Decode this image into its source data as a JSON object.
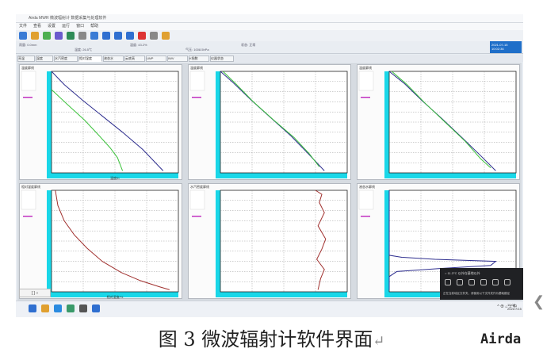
{
  "window": {
    "title": "Airda MWR 微波辐射计 数据采集与处理软件"
  },
  "menu": [
    "文件",
    "查看",
    "设置",
    "运行",
    "窗口",
    "帮助"
  ],
  "toolbar_icons": [
    "save-icon",
    "open-icon",
    "print-icon",
    "chart-icon",
    "calibrate-icon",
    "settings-icon",
    "camera-icon",
    "play-icon",
    "pause-icon",
    "stop-icon",
    "record-icon",
    "antenna-icon",
    "help-icon"
  ],
  "toolbar2": [
    "雨量: 0.0mm",
    "温度: 26.5℃",
    "湿度: 43.2%",
    "气压: 1008.5hPa",
    "状态: 正常"
  ],
  "status_box": [
    "2021-07-15",
    "10:02:36"
  ],
  "tabs": [
    "亮温",
    "温度",
    "水汽密度",
    "相对湿度",
    "液态水",
    "云底高",
    "LWP",
    "IWV",
    "K指数",
    "仪器状态"
  ],
  "tabs_active": 3,
  "colors": {
    "blue_line": "#2f2f8f",
    "green_line": "#3cc23c",
    "red_line": "#a0302e",
    "axis_fill": "#19d7e8",
    "legend_text": "#c030c0"
  },
  "panels": [
    {
      "title": "温度廓线",
      "xlabel": "温度/K"
    },
    {
      "title": "温度廓线",
      "xlabel": ""
    },
    {
      "title": "温度廓线",
      "xlabel": ""
    },
    {
      "title": "相对湿度廓线",
      "xlabel": "相对湿度/%"
    },
    {
      "title": "水汽密度廓线",
      "xlabel": ""
    },
    {
      "title": "液态水廓线",
      "xlabel": ""
    }
  ],
  "chart_data": [
    {
      "type": "line",
      "title": "温度廓线",
      "xlabel": "温度/K",
      "series": [
        {
          "x": [
            250,
            255,
            262,
            270,
            278,
            286,
            294
          ],
          "y": [
            10,
            8.7,
            7.2,
            5.6,
            4.0,
            2.3,
            0.2
          ]
        },
        {
          "x": [
            250,
            256,
            263,
            269,
            273,
            276,
            278
          ],
          "y": [
            8.2,
            6.8,
            5.2,
            3.6,
            2.5,
            1.5,
            0.2
          ]
        }
      ]
    },
    {
      "type": "line",
      "title": "温度廓线",
      "series": [
        {
          "x": [
            250,
            255,
            262,
            270,
            278,
            285,
            291
          ],
          "y": [
            10,
            8.9,
            7.2,
            5.4,
            3.6,
            1.8,
            0.2
          ]
        },
        {
          "x": [
            251,
            256,
            263,
            271,
            279,
            285,
            289
          ],
          "y": [
            10,
            8.8,
            7.0,
            5.2,
            3.5,
            1.9,
            0.6
          ]
        }
      ]
    },
    {
      "type": "line",
      "title": "温度廓线",
      "series": [
        {
          "x": [
            250,
            256,
            263,
            271,
            279,
            286,
            292
          ],
          "y": [
            10,
            8.8,
            7.1,
            5.3,
            3.4,
            1.7,
            0.2
          ]
        },
        {
          "x": [
            251,
            257,
            264,
            272,
            280,
            286,
            290
          ],
          "y": [
            10,
            8.7,
            6.9,
            5.0,
            3.1,
            1.4,
            0.5
          ]
        }
      ]
    },
    {
      "type": "line",
      "title": "相对湿度廓线",
      "xlabel": "相对湿度/%",
      "series": [
        {
          "x": [
            3,
            5,
            10,
            18,
            28,
            40,
            55,
            70,
            85,
            93
          ],
          "y": [
            10,
            8.5,
            7.0,
            5.6,
            4.3,
            3.0,
            1.9,
            1.1,
            0.5,
            0.2
          ]
        }
      ]
    },
    {
      "type": "line",
      "title": "水汽密度廓线",
      "series": [
        {
          "x": [
            75,
            80,
            78,
            82,
            77,
            83,
            80,
            76,
            82,
            79,
            77
          ],
          "y": [
            10,
            9.6,
            8.8,
            7.8,
            6.5,
            5.2,
            4.2,
            3.2,
            2.2,
            1.3,
            0.2
          ]
        }
      ]
    },
    {
      "type": "line",
      "title": "液态水廓线",
      "series": [
        {
          "x": [
            0,
            0,
            5,
            18,
            42,
            40,
            20,
            3,
            0,
            0
          ],
          "y": [
            10,
            3.6,
            3.4,
            3.2,
            3.0,
            2.6,
            2.3,
            2.0,
            1.5,
            0.2
          ]
        }
      ]
    }
  ],
  "taskbar": {
    "apps": [
      "start-icon",
      "explorer-icon",
      "browser-icon",
      "mail-icon",
      "monitor-icon",
      "app-icon"
    ],
    "tray": "^ ⊕ ⌂ ♫ 中",
    "time": [
      "10:02",
      "2021/7/15"
    ]
  },
  "notification": {
    "title": "○ 11.3°C 以外在基地以外",
    "text": "正在当前地区文件夹，请使用以下文件夹作为基础路径"
  },
  "left_button": "[ ] ○",
  "caption": {
    "text": "图 3 微波辐射计软件界面",
    "mark": "↵"
  },
  "watermark": "Airda",
  "edge_glyph": "❮"
}
